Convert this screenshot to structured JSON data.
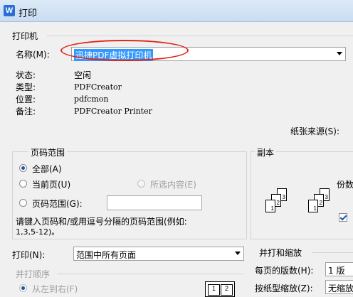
{
  "window": {
    "title": "打印",
    "icon": "wps-writer-icon"
  },
  "printer": {
    "group_label": "打印机",
    "name_label": "名称(M):",
    "name_value": "迅捷PDF虚拟打印机",
    "status_label": "状态:",
    "status_value": "空闲",
    "type_label": "类型:",
    "type_value": "PDFCreator",
    "location_label": "位置:",
    "location_value": "pdfcmon",
    "comment_label": "备注:",
    "comment_value": "PDFCreator Printer",
    "paper_source_label": "纸张来源(S):"
  },
  "page_range": {
    "group_label": "页码范围",
    "all_label": "全部(A)",
    "current_label": "当前页(U)",
    "selection_label": "所选内容(E)",
    "range_label": "页码范围(G):",
    "range_value": "",
    "hint_line1": "请键入页码和/或用逗号分隔的页码范围(例如:",
    "hint_line2": "1,3,5-12)。"
  },
  "copies": {
    "group_label": "副本",
    "count_label": "份数",
    "stack1": [
      "1",
      "2",
      "3"
    ],
    "stack2": [
      "1",
      "2",
      "3"
    ]
  },
  "print_what": {
    "label": "打印(N):",
    "value": "范围中所有页面"
  },
  "order": {
    "group_label": "并打顺序",
    "left_to_right_label": "从左到右(F)",
    "preview": [
      "1",
      "2"
    ]
  },
  "zoom": {
    "group_label": "并打和缩放",
    "pages_per_sheet_label": "每页的版数(H):",
    "pages_per_sheet_value": "1 版",
    "scale_label": "按纸型缩放(Z):",
    "scale_value": "无缩放"
  },
  "colors": {
    "highlight": "#e0251b",
    "selected_bg": "#3399ff",
    "accent": "#1a55b0"
  }
}
